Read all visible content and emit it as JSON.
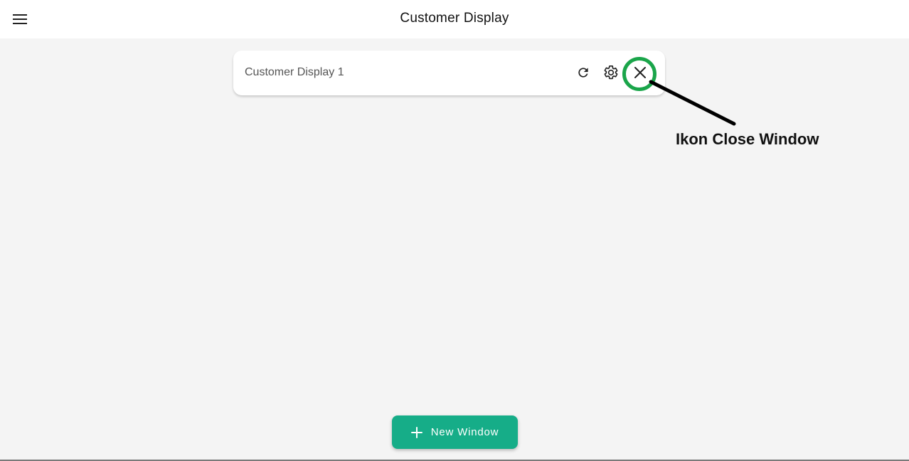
{
  "header": {
    "title": "Customer Display",
    "menu_icon": "hamburger-menu-icon"
  },
  "window_card": {
    "name": "Customer Display 1",
    "actions": {
      "refresh_icon": "refresh-icon",
      "settings_icon": "gear-icon",
      "close_icon": "close-icon"
    }
  },
  "annotation": {
    "label": "Ikon Close Window",
    "highlight_color": "#1aa54a"
  },
  "footer": {
    "new_window_label": "New Window",
    "new_window_icon": "plus-icon"
  },
  "colors": {
    "accent": "#16ad88",
    "background": "#f4f4f4",
    "surface": "#ffffff"
  }
}
